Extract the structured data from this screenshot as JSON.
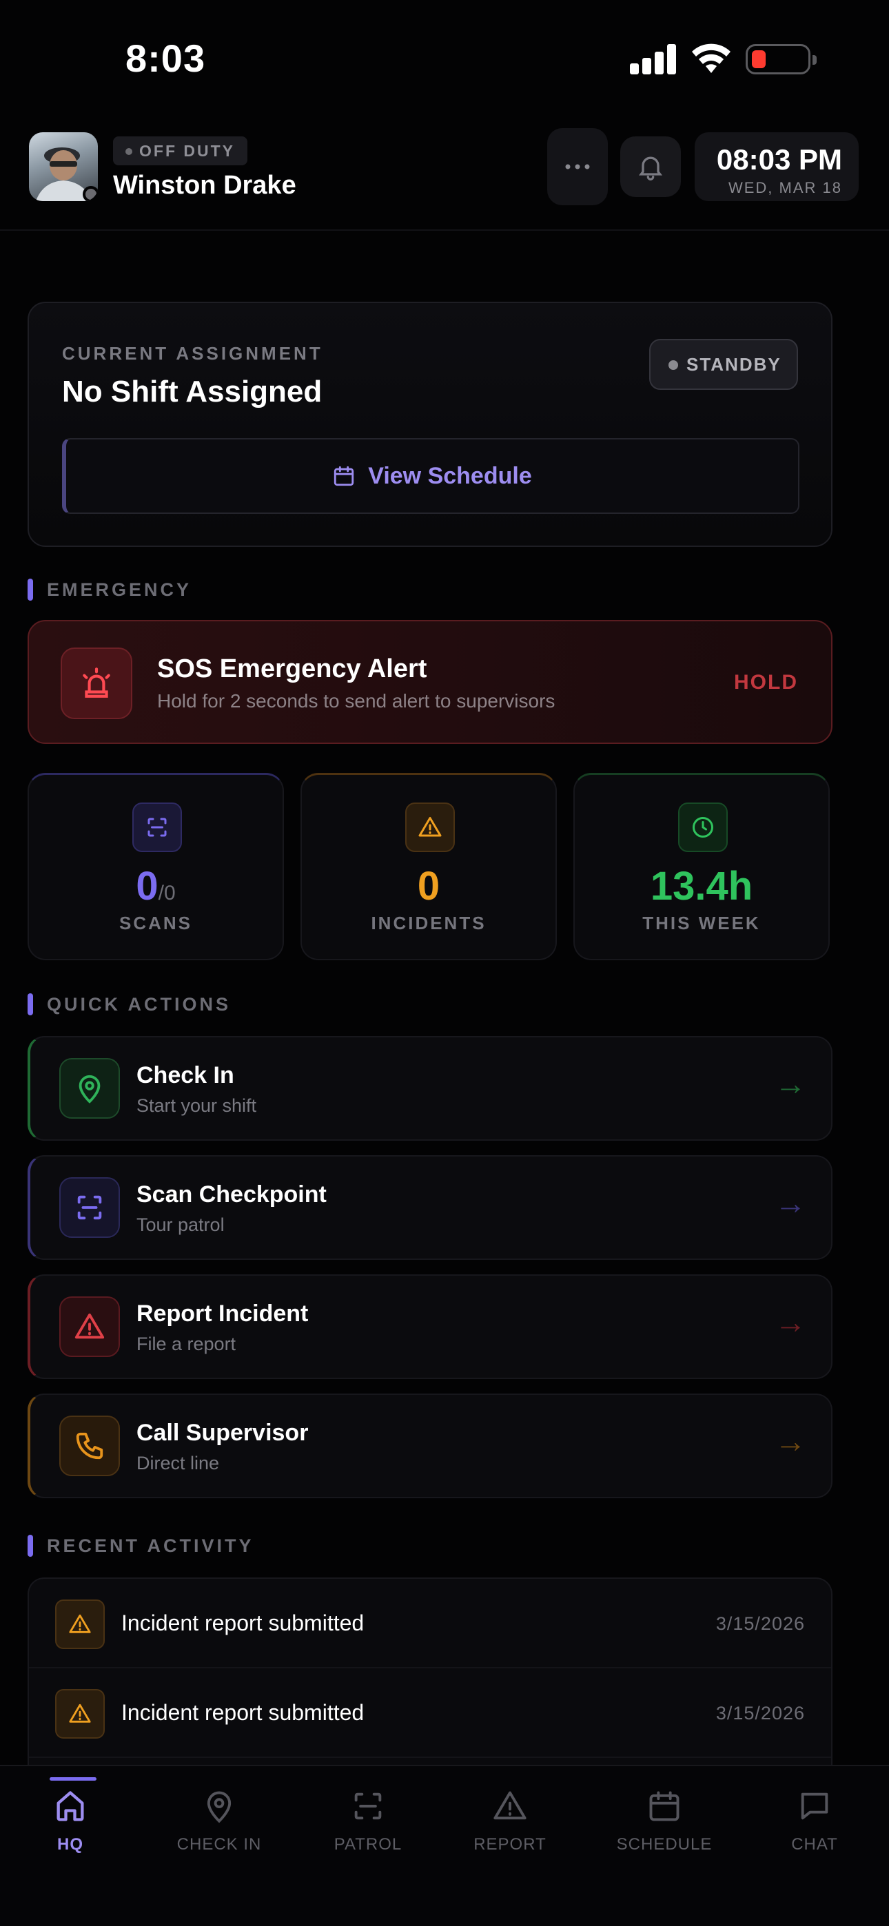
{
  "status_bar": {
    "time": "8:03"
  },
  "header": {
    "duty_status": "OFF DUTY",
    "user_name": "Winston Drake",
    "clock_time": "08:03 PM",
    "clock_date": "WED, MAR 18"
  },
  "assignment": {
    "label": "CURRENT ASSIGNMENT",
    "title": "No Shift Assigned",
    "status": "STANDBY",
    "button_label": "View Schedule"
  },
  "emergency": {
    "section_label": "EMERGENCY",
    "title": "SOS Emergency Alert",
    "subtitle": "Hold for 2 seconds to send alert to supervisors",
    "hold_label": "HOLD"
  },
  "stats": [
    {
      "value": "0",
      "suffix": "/0",
      "label": "SCANS",
      "color": "#7b6cf0"
    },
    {
      "value": "0",
      "label": "INCIDENTS",
      "color": "#f0a020"
    },
    {
      "value": "13.4h",
      "label": "THIS WEEK",
      "color": "#2fc35d"
    }
  ],
  "quick_actions": {
    "section_label": "QUICK ACTIONS",
    "items": [
      {
        "title": "Check In",
        "subtitle": "Start your shift",
        "icon": "location-pin-icon",
        "color": "#2fb35a"
      },
      {
        "title": "Scan Checkpoint",
        "subtitle": "Tour patrol",
        "icon": "scan-icon",
        "color": "#7b6cf0"
      },
      {
        "title": "Report Incident",
        "subtitle": "File a report",
        "icon": "warning-icon",
        "color": "#e04048"
      },
      {
        "title": "Call Supervisor",
        "subtitle": "Direct line",
        "icon": "phone-icon",
        "color": "#e8941c"
      }
    ]
  },
  "recent_activity": {
    "section_label": "RECENT ACTIVITY",
    "items": [
      {
        "text": "Incident report submitted",
        "date": "3/15/2026"
      },
      {
        "text": "Incident report submitted",
        "date": "3/15/2026"
      }
    ]
  },
  "tabs": [
    {
      "label": "HQ",
      "icon": "home-icon",
      "active": true
    },
    {
      "label": "CHECK IN",
      "icon": "location-pin-icon"
    },
    {
      "label": "PATROL",
      "icon": "scan-icon"
    },
    {
      "label": "REPORT",
      "icon": "warning-icon"
    },
    {
      "label": "SCHEDULE",
      "icon": "calendar-icon"
    },
    {
      "label": "CHAT",
      "icon": "chat-icon"
    }
  ]
}
